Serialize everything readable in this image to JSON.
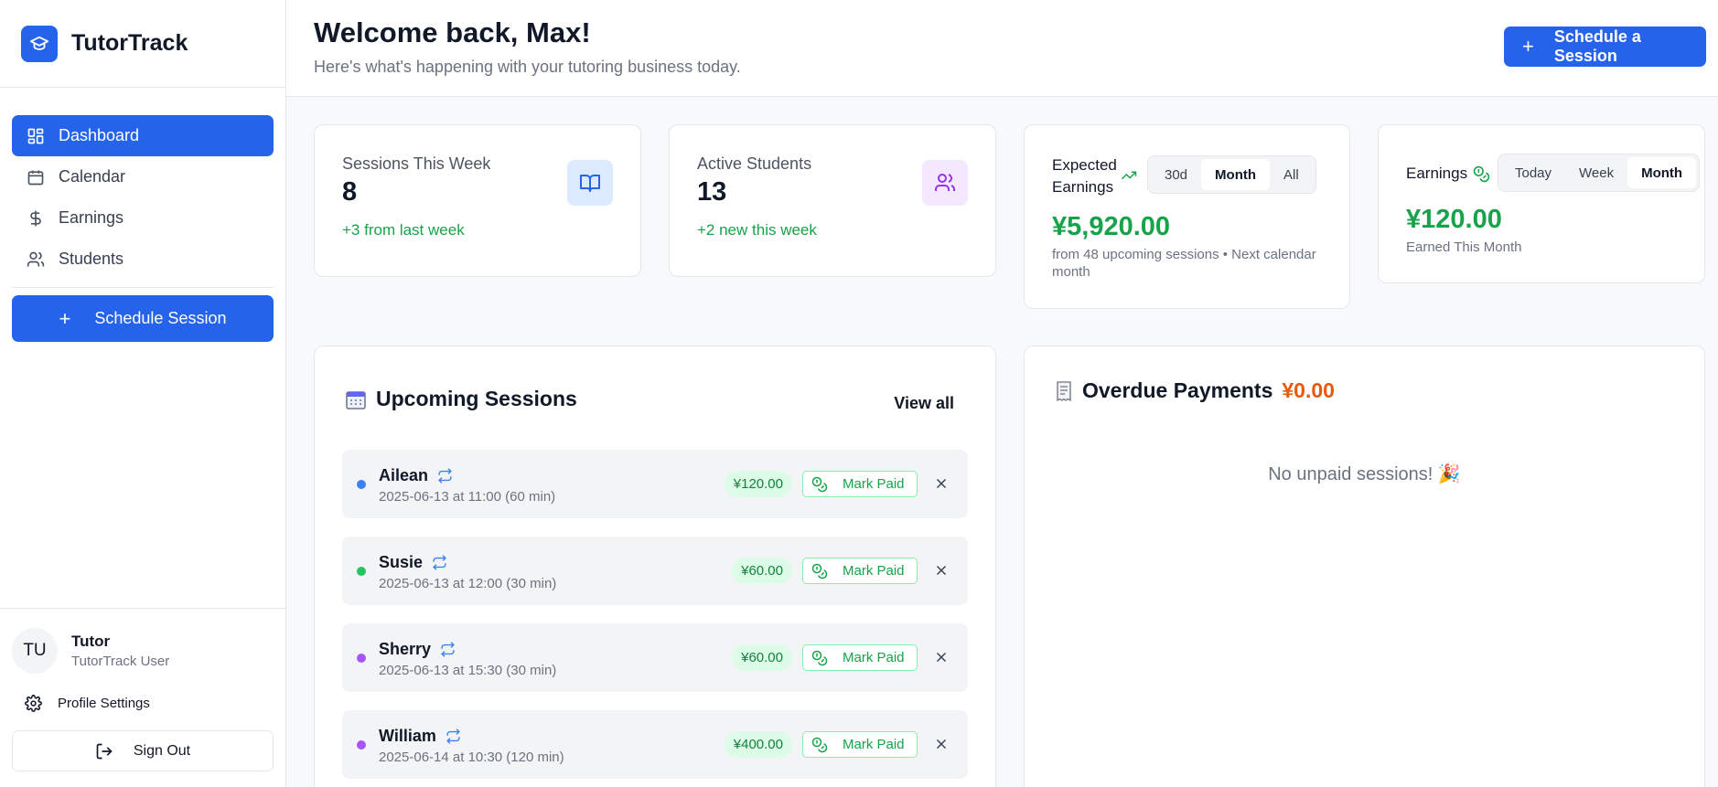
{
  "brand": {
    "name": "TutorTrack"
  },
  "nav": {
    "items": [
      {
        "label": "Dashboard",
        "icon": "dashboard-icon",
        "active": true
      },
      {
        "label": "Calendar",
        "icon": "calendar-icon"
      },
      {
        "label": "Earnings",
        "icon": "dollar-icon"
      },
      {
        "label": "Students",
        "icon": "users-icon"
      }
    ],
    "schedule_label": "Schedule Session"
  },
  "user": {
    "initials": "TU",
    "name": "Tutor",
    "role": "TutorTrack User"
  },
  "footer": {
    "profile_label": "Profile Settings",
    "signout_label": "Sign Out"
  },
  "header": {
    "title": "Welcome back, Max!",
    "subtitle": "Here's what's happening with your tutoring business today.",
    "schedule_btn": "Schedule a Session"
  },
  "stats": {
    "sessions": {
      "label": "Sessions This Week",
      "value": "8",
      "delta": "+3 from last week"
    },
    "students": {
      "label": "Active Students",
      "value": "13",
      "delta": "+2 new this week"
    }
  },
  "expected": {
    "label_line1": "Expected",
    "label_line2": "Earnings",
    "options": [
      "30d",
      "Month",
      "All"
    ],
    "selected": "Month",
    "amount": "¥5,920.00",
    "note": "from 48 upcoming sessions • Next calendar month"
  },
  "earnings": {
    "label": "Earnings",
    "options": [
      "Today",
      "Week",
      "Month"
    ],
    "selected": "Month",
    "amount": "¥120.00",
    "caption": "Earned This Month"
  },
  "upcoming": {
    "title": "Upcoming Sessions",
    "view_all": "View all",
    "mark_paid_label": "Mark Paid",
    "sessions": [
      {
        "name": "Ailean",
        "when": "2025-06-13 at 11:00 (60 min)",
        "price": "¥120.00",
        "dot_color": "#3b82f6"
      },
      {
        "name": "Susie",
        "when": "2025-06-13 at 12:00 (30 min)",
        "price": "¥60.00",
        "dot_color": "#22c55e"
      },
      {
        "name": "Sherry",
        "when": "2025-06-13 at 15:30 (30 min)",
        "price": "¥60.00",
        "dot_color": "#a855f7"
      },
      {
        "name": "William",
        "when": "2025-06-14 at 10:30 (120 min)",
        "price": "¥400.00",
        "dot_color": "#a855f7"
      }
    ]
  },
  "overdue": {
    "title": "Overdue Payments",
    "amount": "¥0.00",
    "empty_message": "No unpaid sessions! 🎉"
  },
  "colors": {
    "primary": "#2563eb",
    "success": "#16a34a",
    "warning": "#ea580c"
  }
}
